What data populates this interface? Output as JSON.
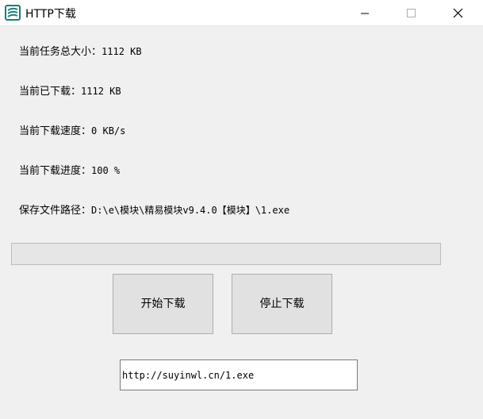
{
  "window": {
    "title": "HTTP下载"
  },
  "info": {
    "total_size_label": "当前任务总大小：",
    "total_size_value": "1112 KB",
    "downloaded_label": "当前已下载：",
    "downloaded_value": "1112 KB",
    "speed_label": "当前下载速度：",
    "speed_value": "0 KB/s",
    "progress_label": "当前下载进度：",
    "progress_value": "100 %",
    "save_path_label": "保存文件路径：",
    "save_path_value": "D:\\e\\模块\\精易模块v9.4.0【模块】\\1.exe"
  },
  "progress": {
    "percent": 100
  },
  "buttons": {
    "start_label": "开始下载",
    "stop_label": "停止下载"
  },
  "url_field": {
    "value": "http://suyinwl.cn/1.exe"
  },
  "colors": {
    "accent": "#1a7f7a",
    "window_bg": "#f0f0f0",
    "button_bg": "#e1e1e1"
  },
  "icons": {
    "app": "app-logo-icon",
    "minimize": "minimize-icon",
    "maximize": "maximize-icon",
    "close": "close-icon"
  }
}
